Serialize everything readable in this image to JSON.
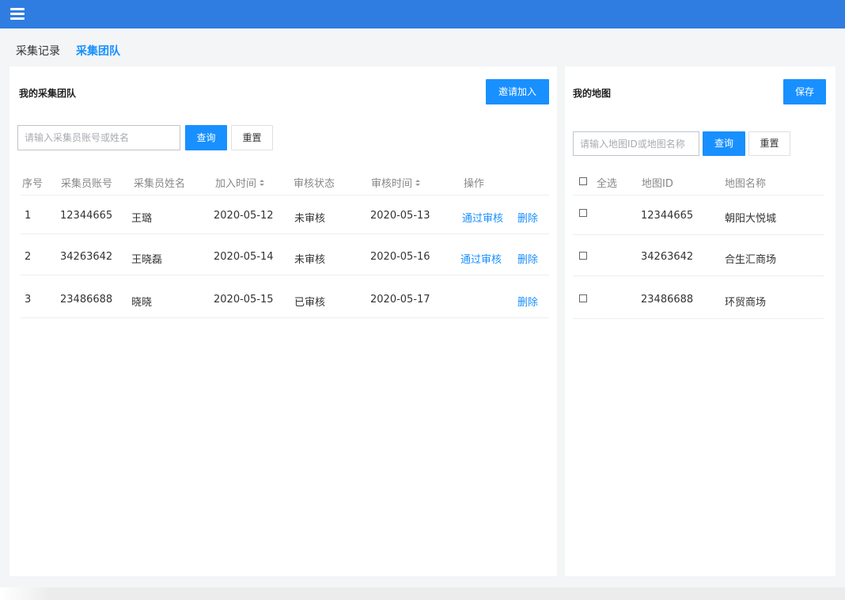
{
  "tabs": [
    {
      "label": "采集记录",
      "active": false
    },
    {
      "label": "采集团队",
      "active": true
    }
  ],
  "team_panel": {
    "title": "我的采集团队",
    "invite_button": "邀请加入",
    "search": {
      "placeholder": "请输入采集员账号或姓名",
      "value": ""
    },
    "query_button": "查询",
    "reset_button": "重置",
    "columns": [
      "序号",
      "采集员账号",
      "采集员姓名",
      "加入时间",
      "审核状态",
      "审核时间",
      "操作"
    ],
    "rows": [
      {
        "index": "1",
        "account": "12344665",
        "name": "王璐",
        "join_date": "2020-05-12",
        "status": "未审核",
        "review_date": "2020-05-13",
        "approve": "通过审核",
        "delete": "删除"
      },
      {
        "index": "2",
        "account": "34263642",
        "name": "王晓磊",
        "join_date": "2020-05-14",
        "status": "未审核",
        "review_date": "2020-05-16",
        "approve": "通过审核",
        "delete": "删除"
      },
      {
        "index": "3",
        "account": "23486688",
        "name": "晓晓",
        "join_date": "2020-05-15",
        "status": "已审核",
        "review_date": "2020-05-17",
        "approve": "",
        "delete": "删除"
      }
    ]
  },
  "map_panel": {
    "title": "我的地图",
    "save_button": "保存",
    "search": {
      "placeholder": "请输入地图ID或地图名称",
      "value": ""
    },
    "query_button": "查询",
    "reset_button": "重置",
    "columns": [
      "全选",
      "地图ID",
      "地图名称"
    ],
    "rows": [
      {
        "map_id": "12344665",
        "map_name": "朝阳大悦城",
        "checked": false
      },
      {
        "map_id": "34263642",
        "map_name": "合生汇商场",
        "checked": false
      },
      {
        "map_id": "23486688",
        "map_name": "环贸商场",
        "checked": false
      }
    ]
  },
  "colors": {
    "accent": "#1890ff",
    "topbar": "#2f7de1"
  }
}
